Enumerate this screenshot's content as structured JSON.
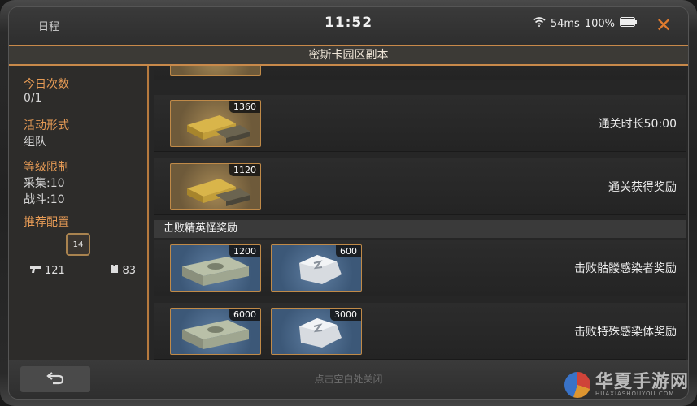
{
  "status": {
    "schedule_label": "日程",
    "time": "11:52",
    "latency": "54ms",
    "battery": "100%",
    "close_icon": "close-icon"
  },
  "title": "密斯卡园区副本",
  "info": {
    "daily_count_label": "今日次数",
    "daily_count_value": "0/1",
    "activity_type_label": "活动形式",
    "activity_type_value": "组队",
    "level_limit_label": "等级限制",
    "gather_level": "采集:10",
    "combat_level": "战斗:10",
    "recommended_label": "推荐配置",
    "recommended_level": "14",
    "attack_value": "121",
    "defense_value": "83"
  },
  "rewards": [
    {
      "desc": "通关时长50:00",
      "items": [
        {
          "type": "gold-bars",
          "count": "1360"
        }
      ]
    },
    {
      "desc": "通关获得奖励",
      "items": [
        {
          "type": "gold-bars",
          "count": "1120"
        }
      ]
    }
  ],
  "elite_section_label": "击败精英怪奖励",
  "elite_rewards": [
    {
      "desc": "击败骷髅感染者奖励",
      "items": [
        {
          "type": "cash-stack",
          "count": "1200"
        },
        {
          "type": "silver-ore",
          "count": "600"
        }
      ]
    },
    {
      "desc": "击败特殊感染体奖励",
      "items": [
        {
          "type": "cash-stack",
          "count": "6000"
        },
        {
          "type": "silver-ore",
          "count": "3000"
        }
      ]
    }
  ],
  "footer": {
    "tap_hint": "点击空白处关闭"
  },
  "watermark": {
    "cn": "华夏手游网",
    "en": "HUAXIASHOUYOU.COM"
  },
  "colors": {
    "accent_orange": "#e59a55",
    "frame_border": "#c8894a",
    "close_orange": "#e07b2e"
  }
}
